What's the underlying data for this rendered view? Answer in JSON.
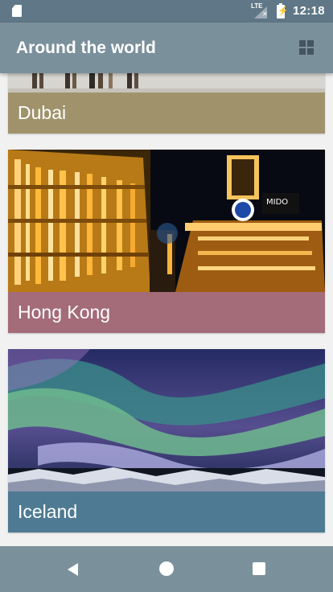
{
  "status_bar": {
    "network": "LTE",
    "time": "12:18",
    "icons": [
      "sd-card-icon",
      "cell-signal-icon",
      "battery-charging-icon"
    ]
  },
  "toolbar": {
    "title": "Around the world",
    "action_icon": "grid-view-icon"
  },
  "destinations": [
    {
      "name": "Dubai",
      "caption_color": "#a0936c",
      "image": "city-street-fragment"
    },
    {
      "name": "Hong Kong",
      "caption_color": "#a46b79",
      "image": "night-city-buildings"
    },
    {
      "name": "Iceland",
      "caption_color": "#4f7a93",
      "image": "aurora-over-glacier"
    }
  ],
  "navigation_bar": {
    "buttons": [
      "back-icon",
      "home-icon",
      "recents-icon"
    ]
  }
}
